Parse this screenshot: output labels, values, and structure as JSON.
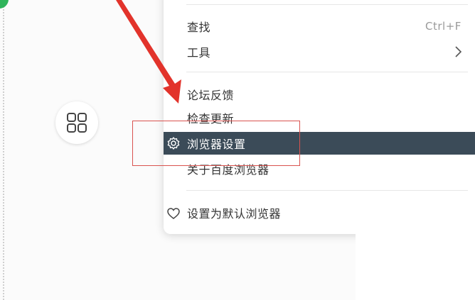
{
  "menu": {
    "items": [
      {
        "label": "查找",
        "shortcut": "Ctrl+F"
      },
      {
        "label": "工具"
      },
      {
        "label": "论坛反馈"
      },
      {
        "label": "检查更新"
      },
      {
        "label": "浏览器设置"
      },
      {
        "label": "关于百度浏览器"
      },
      {
        "label": "设置为默认浏览器"
      }
    ]
  },
  "icons": {
    "apps": "grid-four-squares-icon",
    "tools_submenu": "chevron-right-icon",
    "settings": "gear-icon",
    "default_browser": "heart-icon"
  },
  "colors": {
    "active_item_bg": "#3b4b58",
    "annotation_red": "#d9534f",
    "arrow_red": "#e2332b",
    "green_badge": "#2fb45a"
  }
}
